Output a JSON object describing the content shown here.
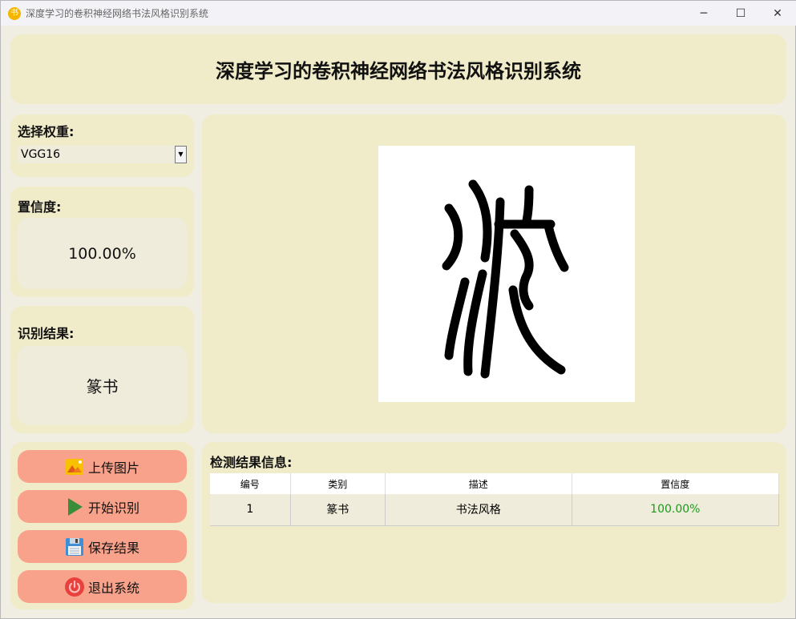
{
  "window": {
    "title": "深度学习的卷积神经网络书法风格识别系统",
    "minimize": "─",
    "maximize": "☐",
    "close": "✕"
  },
  "header": {
    "title": "深度学习的卷积神经网络书法风格识别系统"
  },
  "weights": {
    "label": "选择权重:",
    "selected": "VGG16"
  },
  "confidence": {
    "label": "置信度:",
    "value": "100.00%"
  },
  "result": {
    "label": "识别结果:",
    "value": "篆书"
  },
  "buttons": {
    "upload": "上传图片",
    "start": "开始识别",
    "save": "保存结果",
    "exit": "退出系统"
  },
  "table": {
    "title": "检测结果信息:",
    "columns": [
      "编号",
      "类别",
      "描述",
      "置信度"
    ],
    "rows": [
      [
        "1",
        "篆书",
        "书法风格",
        "100.00%"
      ]
    ]
  },
  "colors": {
    "confidence_text": "#1a9a1a",
    "button": "#f8a28b",
    "panel": "#f0ebc9"
  }
}
